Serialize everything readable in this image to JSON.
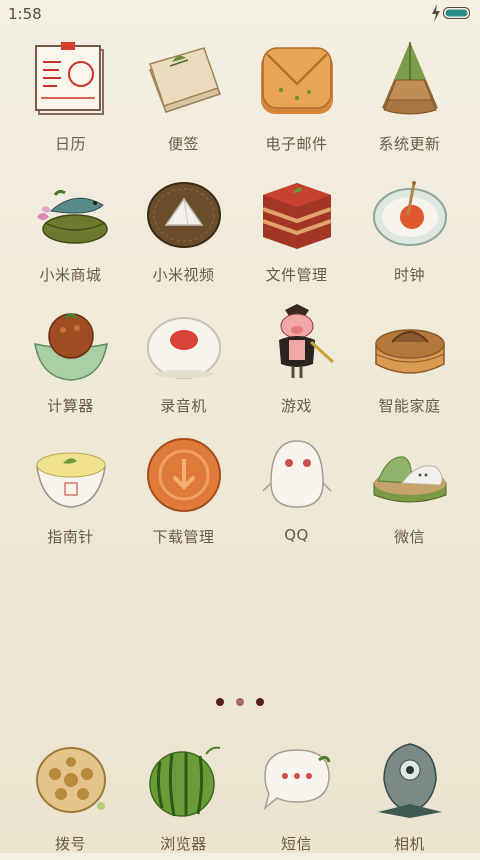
{
  "status_bar": {
    "time": "1:58",
    "icons": [
      "charging-bolt-icon",
      "battery-icon"
    ]
  },
  "apps": [
    {
      "label": "日历"
    },
    {
      "label": "便签"
    },
    {
      "label": "电子邮件"
    },
    {
      "label": "系统更新"
    },
    {
      "label": "小米商城"
    },
    {
      "label": "小米视频"
    },
    {
      "label": "文件管理"
    },
    {
      "label": "时钟"
    },
    {
      "label": "计算器"
    },
    {
      "label": "录音机"
    },
    {
      "label": "游戏"
    },
    {
      "label": "智能家庭"
    },
    {
      "label": "指南针"
    },
    {
      "label": "下载管理"
    },
    {
      "label": "QQ"
    },
    {
      "label": "微信"
    }
  ],
  "dock": [
    {
      "label": "拨号"
    },
    {
      "label": "浏览器"
    },
    {
      "label": "短信"
    },
    {
      "label": "相机"
    }
  ],
  "page_indicator": {
    "pages": 3,
    "current": 2
  }
}
